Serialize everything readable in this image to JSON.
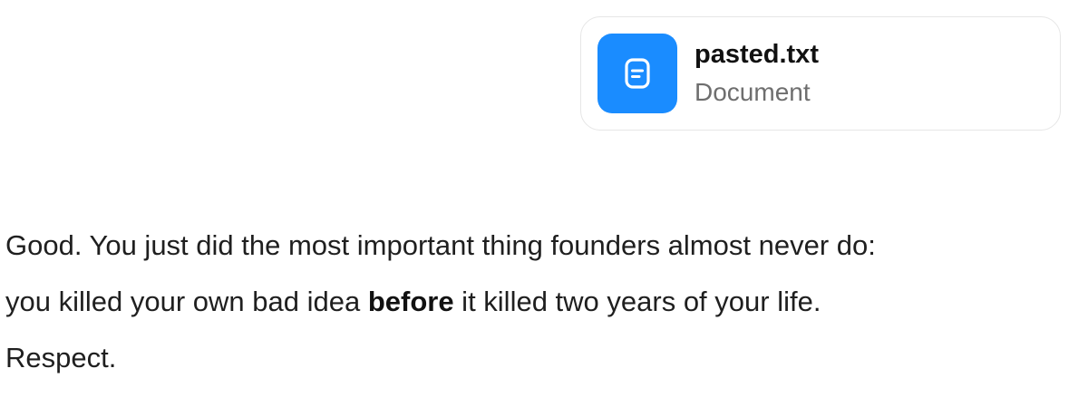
{
  "attachment": {
    "name": "pasted.txt",
    "type": "Document",
    "icon": "document-icon",
    "accent_color": "#1a8cff"
  },
  "message": {
    "line1": "Good. You just did the most important thing founders almost never do:",
    "line2_before": "you killed your own bad idea ",
    "line2_bold": "before",
    "line2_after": " it killed two years of your life.",
    "line3": "Respect."
  }
}
